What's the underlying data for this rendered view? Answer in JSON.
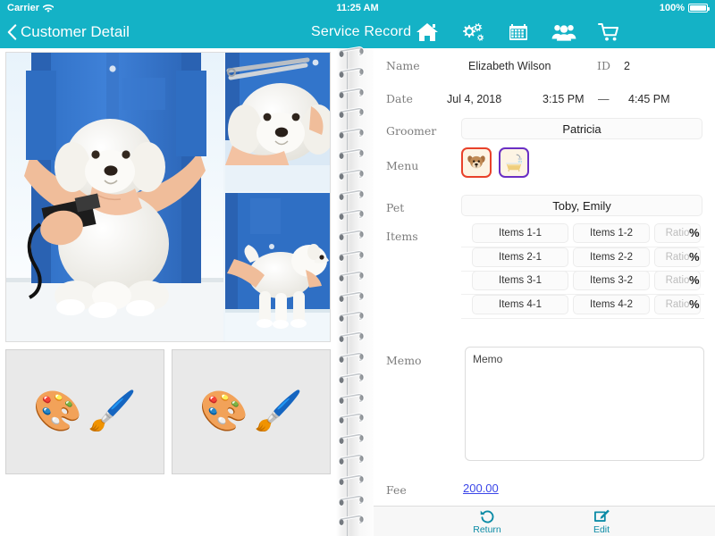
{
  "status_bar": {
    "carrier": "Carrier",
    "wifi_icon": "wifi-icon",
    "time": "11:25 AM",
    "battery_percent": "100%",
    "battery_icon": "battery-full-icon"
  },
  "nav_bar": {
    "back_label": "Customer Detail",
    "back_icon": "chevron-left-icon",
    "title": "Service Record",
    "icons": [
      {
        "name": "home-icon",
        "label": "Home"
      },
      {
        "name": "gears-icon",
        "label": "Settings"
      },
      {
        "name": "calendar-icon",
        "label": "Calendar"
      },
      {
        "name": "people-group-icon",
        "label": "Customers"
      },
      {
        "name": "shopping-cart-icon",
        "label": "Store"
      }
    ],
    "accent_color": "#14b2c6"
  },
  "photos": {
    "collage_alt": "Groomer in blue shirt clipping a white poodle",
    "panels": [
      {
        "name": "photo-main",
        "alt": "Groomer holding white poodle with clippers"
      },
      {
        "name": "photo-top-right",
        "alt": "Close-up of poodle face with scissors"
      },
      {
        "name": "photo-bottom-right",
        "alt": "Full body white poodle standing on table"
      }
    ],
    "thumbnails": [
      {
        "name": "thumbnail-placeholder-1",
        "icon": "artist-palette-icon",
        "glyph": "🎨",
        "brush": "🖌️"
      },
      {
        "name": "thumbnail-placeholder-2",
        "icon": "artist-palette-icon",
        "glyph": "🎨",
        "brush": "🖌️"
      }
    ]
  },
  "record": {
    "name_label": "Name",
    "name_value": "Elizabeth Wilson",
    "id_label": "ID",
    "id_value": "2",
    "date_label": "Date",
    "date_value": "Jul 4, 2018",
    "time_start": "3:15 PM",
    "time_separator": "—",
    "time_end": "4:45 PM",
    "groomer_label": "Groomer",
    "groomer_value": "Patricia",
    "menu_label": "Menu",
    "menu_items": [
      {
        "name": "menu-icon-dog",
        "glyph": "🐶",
        "border_color": "#e8412a"
      },
      {
        "name": "menu-icon-bath",
        "glyph": "🛁",
        "border_color": "#6a2fc4"
      }
    ],
    "pet_label": "Pet",
    "pet_value": "Toby, Emily",
    "items_label": "Items",
    "ratio_placeholder": "Ratio",
    "percent_symbol": "%",
    "items_rows": [
      {
        "col1": "Items 1-1",
        "col2": "Items 1-2",
        "ratio": ""
      },
      {
        "col1": "Items 2-1",
        "col2": "Items 2-2",
        "ratio": ""
      },
      {
        "col1": "Items 3-1",
        "col2": "Items 3-2",
        "ratio": ""
      },
      {
        "col1": "Items 4-1",
        "col2": "Items 4-2",
        "ratio": ""
      }
    ],
    "memo_label": "Memo",
    "memo_placeholder": "Memo",
    "memo_value": "Memo",
    "fee_label": "Fee",
    "fee_value": "200.00",
    "fee_color": "#3b46e8"
  },
  "toolbar": {
    "return_label": "Return",
    "return_icon": "undo-arrow-icon",
    "edit_label": "Edit",
    "edit_icon": "pencil-square-icon",
    "tint_color": "#0b8ba6"
  }
}
